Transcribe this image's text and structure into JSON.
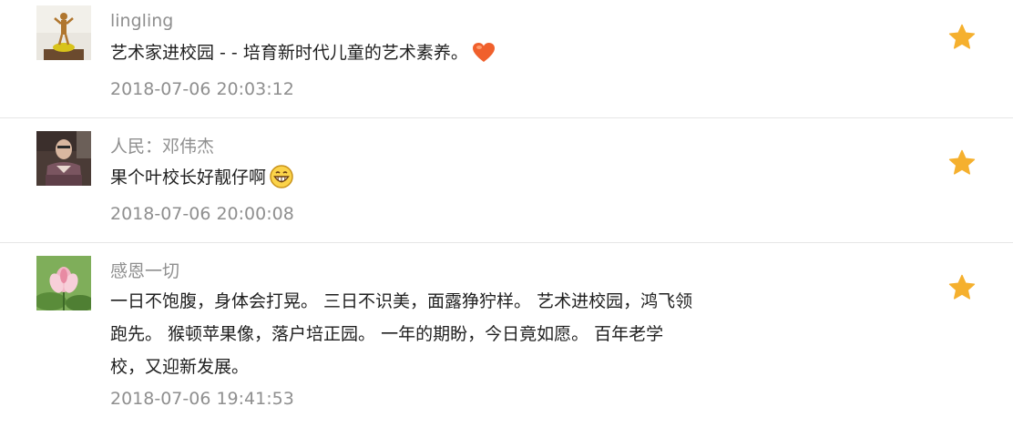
{
  "comments": [
    {
      "nickname": "lingling",
      "content_lines": [
        "艺术家进校园 -  - 培育新时代儿童的艺术素养。"
      ],
      "emoji": "heart-emoji",
      "time": "2018-07-06 20:03:12",
      "starred": true
    },
    {
      "nickname": "人民：邓伟杰",
      "content_lines": [
        "果个叶校长好靓仔啊"
      ],
      "emoji": "grinning-face-emoji",
      "time": "2018-07-06 20:00:08",
      "starred": true
    },
    {
      "nickname": "感恩一切",
      "content_lines": [
        "一日不饱腹，身体会打晃。 三日不识美，面露狰狞样。 艺术进校园，鸿飞领",
        "跑先。 猴顿苹果像，落户培正园。 一年的期盼，今日竟如愿。 百年老学",
        "校，又迎新发展。"
      ],
      "emoji": "",
      "time": "2018-07-06 19:41:53",
      "starred": true
    }
  ],
  "colors": {
    "star": "#f5b02e",
    "nickname": "#8f8f8f",
    "content": "#1f1f1f",
    "divider": "#e6e6e6"
  }
}
